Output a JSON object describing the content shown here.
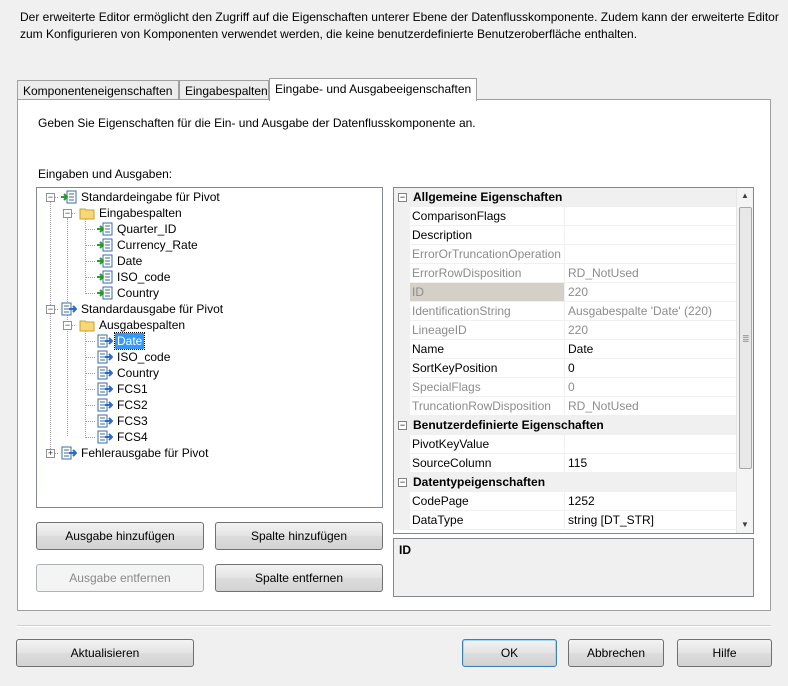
{
  "intro_text": "Der erweiterte Editor ermöglicht den Zugriff auf die Eigenschaften unterer Ebene der Datenflusskomponente. Zudem kann der erweiterte Editor zum Konfigurieren von Komponenten verwendet werden, die keine benutzerdefinierte Benutzeroberfläche enthalten.",
  "tabs": [
    {
      "label": "Komponenteneigenschaften"
    },
    {
      "label": "Eingabespalten"
    },
    {
      "label": "Eingabe- und Ausgabeeigenschaften"
    }
  ],
  "panel_description": "Geben Sie Eigenschaften für die Ein- und Ausgabe der Datenflusskomponente an.",
  "io_label": "Eingaben und Ausgaben:",
  "tree": {
    "input": "Standardeingabe für Pivot",
    "input_columns_folder": "Eingabespalten",
    "input_columns": [
      "Quarter_ID",
      "Currency_Rate",
      "Date",
      "ISO_code",
      "Country"
    ],
    "output": "Standardausgabe für Pivot",
    "output_columns_folder": "Ausgabespalten",
    "output_columns": [
      "Date",
      "ISO_code",
      "Country",
      "FCS1",
      "FCS2",
      "FCS3",
      "FCS4"
    ],
    "selected": "Date",
    "error_output": "Fehlerausgabe für Pivot"
  },
  "properties": {
    "cat_general": "Allgemeine Eigenschaften",
    "general": [
      {
        "name": "ComparisonFlags",
        "value": "",
        "readonly": false
      },
      {
        "name": "Description",
        "value": "",
        "readonly": false
      },
      {
        "name": "ErrorOrTruncationOperation",
        "value": "",
        "readonly": true
      },
      {
        "name": "ErrorRowDisposition",
        "value": "RD_NotUsed",
        "readonly": true
      },
      {
        "name": "ID",
        "value": "220",
        "readonly": true
      },
      {
        "name": "IdentificationString",
        "value": "Ausgabespalte 'Date' (220)",
        "readonly": true
      },
      {
        "name": "LineageID",
        "value": "220",
        "readonly": true
      },
      {
        "name": "Name",
        "value": "Date",
        "readonly": false
      },
      {
        "name": "SortKeyPosition",
        "value": "0",
        "readonly": false
      },
      {
        "name": "SpecialFlags",
        "value": "0",
        "readonly": true
      },
      {
        "name": "TruncationRowDisposition",
        "value": "RD_NotUsed",
        "readonly": true
      }
    ],
    "cat_custom": "Benutzerdefinierte Eigenschaften",
    "custom": [
      {
        "name": "PivotKeyValue",
        "value": "",
        "readonly": false
      },
      {
        "name": "SourceColumn",
        "value": "115",
        "readonly": false
      }
    ],
    "cat_datatype": "Datentypeigenschaften",
    "datatype": [
      {
        "name": "CodePage",
        "value": "1252",
        "readonly": false
      },
      {
        "name": "DataType",
        "value": "string [DT_STR]",
        "readonly": false
      }
    ]
  },
  "description_title": "ID",
  "buttons": {
    "add_output": "Ausgabe hinzufügen",
    "add_column": "Spalte hinzufügen",
    "remove_output": "Ausgabe entfernen",
    "remove_column": "Spalte entfernen",
    "refresh": "Aktualisieren",
    "ok": "OK",
    "cancel": "Abbrechen",
    "help": "Hilfe"
  }
}
